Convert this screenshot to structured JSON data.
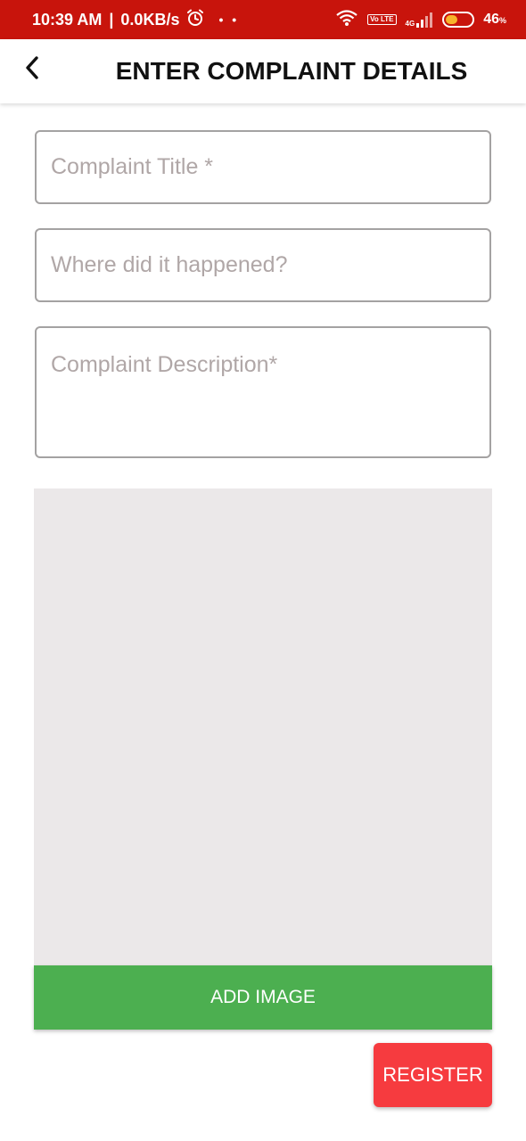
{
  "status_bar": {
    "time": "10:39 AM",
    "data_speed": "0.0KB/s",
    "alarm_icon": "alarm-clock-icon",
    "dots": "• •",
    "volte_label": "Vo LTE",
    "network_label": "4G",
    "battery_percent": "46",
    "battery_unit": "%",
    "battery_level": 0.46,
    "battery_color": "#f7b32b",
    "background_color": "#c8140c"
  },
  "app_bar": {
    "title": "ENTER COMPLAINT DETAILS",
    "back_icon": "chevron-left-icon"
  },
  "form": {
    "title_placeholder": "Complaint Title *",
    "title_value": "",
    "location_placeholder": "Where did it happened?",
    "location_value": "",
    "description_placeholder": "Complaint Description*",
    "description_value": ""
  },
  "image_section": {
    "add_image_label": "ADD IMAGE",
    "add_image_color": "#4caf50",
    "preview_color": "#ebe8e9"
  },
  "actions": {
    "register_label": "REGISTER",
    "register_color": "#f63b3f"
  }
}
